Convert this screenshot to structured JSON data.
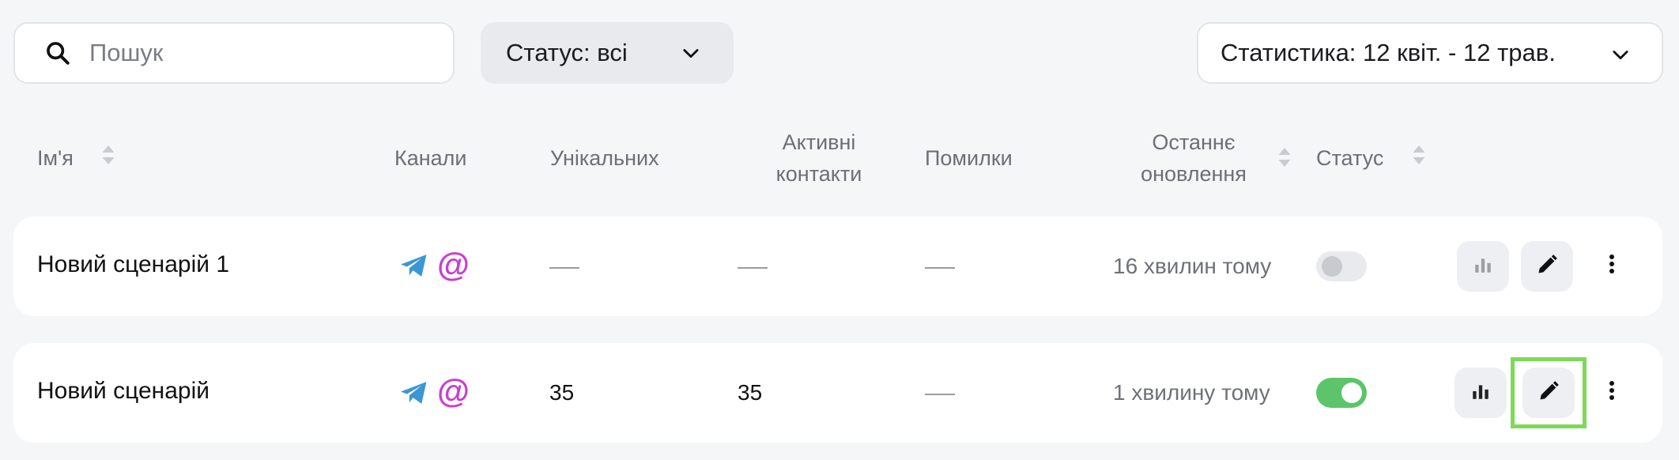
{
  "toolbar": {
    "search_placeholder": "Пошук",
    "status_filter_label": "Статус: всі",
    "stats_filter_label": "Статистика: 12 квіт. - 12 трав."
  },
  "table": {
    "headers": {
      "name": "Ім'я",
      "channels": "Канали",
      "unique": "Унікальних",
      "active_line1": "Активні",
      "active_line2": "контакти",
      "errors": "Помилки",
      "updated_line1": "Останнє",
      "updated_line2": "оновлення",
      "status": "Статус"
    },
    "rows": [
      {
        "name": "Новий сценарій 1",
        "channels": [
          "telegram-icon",
          "email-icon"
        ],
        "unique": "—",
        "active": "—",
        "errors": "—",
        "updated": "16 хвилин тому",
        "status_on": false
      },
      {
        "name": "Новий сценарій",
        "channels": [
          "telegram-icon",
          "email-icon"
        ],
        "unique": "35",
        "active": "35",
        "errors": "—",
        "updated": "1 хвилину тому",
        "status_on": true
      }
    ]
  },
  "colors": {
    "toggle_on": "#5cc46a",
    "toggle_off": "#e9eaed",
    "email_icon": "#c83fd0",
    "telegram_icon": "#3b97d3",
    "highlight": "#7ed957"
  }
}
